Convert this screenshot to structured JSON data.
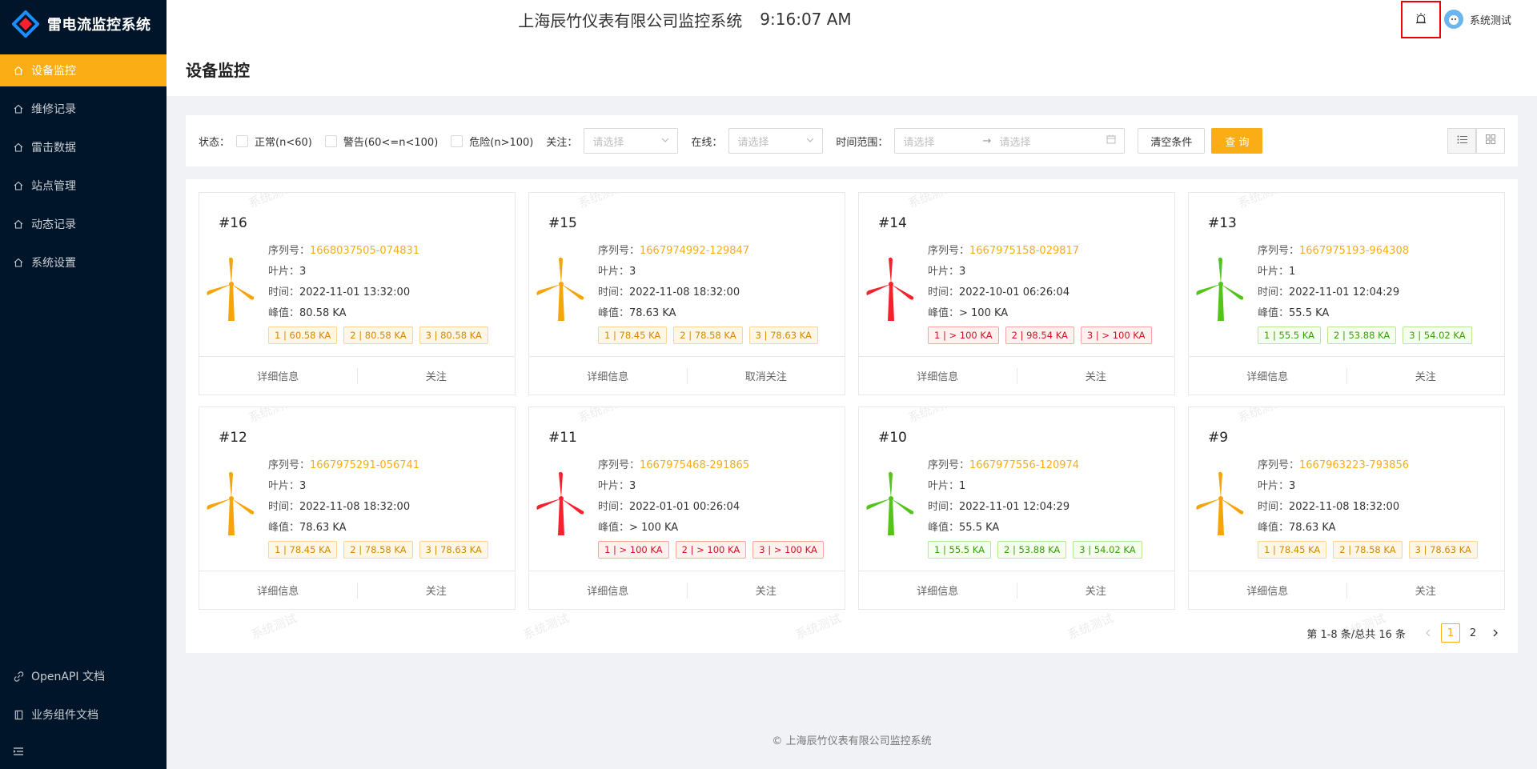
{
  "app": {
    "logo_text": "雷电流监控系统",
    "header_title": "上海辰竹仪表有限公司监控系统",
    "clock": "9:16:07 AM",
    "user_name": "系统测试"
  },
  "sidebar": {
    "items": [
      {
        "label": "设备监控",
        "icon": "home-icon",
        "active": true
      },
      {
        "label": "维修记录",
        "icon": "home-icon"
      },
      {
        "label": "雷击数据",
        "icon": "home-icon"
      },
      {
        "label": "站点管理",
        "icon": "home-icon"
      },
      {
        "label": "动态记录",
        "icon": "home-icon"
      },
      {
        "label": "系统设置",
        "icon": "home-icon"
      }
    ],
    "bottom": [
      {
        "label": "OpenAPI 文档",
        "icon": "link-icon"
      },
      {
        "label": "业务组件文档",
        "icon": "book-icon"
      }
    ]
  },
  "page": {
    "title": "设备监控"
  },
  "filter": {
    "status_label": "状态：",
    "status_options": [
      "正常(n<60)",
      "警告(60<=n<100)",
      "危险(n>100)"
    ],
    "follow_label": "关注：",
    "follow_placeholder": "请选择",
    "online_label": "在线：",
    "online_placeholder": "请选择",
    "time_label": "时间范围：",
    "time_start_placeholder": "请选择",
    "time_end_placeholder": "请选择",
    "clear_label": "清空条件",
    "query_label": "查 询"
  },
  "labels": {
    "serial": "序列号：",
    "blades": "叶片：",
    "time": "时间：",
    "peak": "峰值：",
    "detail": "详细信息"
  },
  "watermark": "系统测试",
  "cards": [
    {
      "id": "#16",
      "serial": "1668037505-074831",
      "blades": "3",
      "time": "2022-11-01 13:32:00",
      "peak": "80.58 KA",
      "level": "orange",
      "tags": [
        "1 | 60.58 KA",
        "2 | 80.58 KA",
        "3 | 80.58 KA"
      ],
      "follow": "关注"
    },
    {
      "id": "#15",
      "serial": "1667974992-129847",
      "blades": "3",
      "time": "2022-11-08 18:32:00",
      "peak": "78.63 KA",
      "level": "orange",
      "tags": [
        "1 | 78.45 KA",
        "2 | 78.58 KA",
        "3 | 78.63 KA"
      ],
      "follow": "取消关注"
    },
    {
      "id": "#14",
      "serial": "1667975158-029817",
      "blades": "3",
      "time": "2022-10-01 06:26:04",
      "peak": "> 100 KA",
      "level": "red",
      "tags": [
        "1 | > 100 KA",
        "2 | 98.54 KA",
        "3 | > 100 KA"
      ],
      "follow": "关注"
    },
    {
      "id": "#13",
      "serial": "1667975193-964308",
      "blades": "1",
      "time": "2022-11-01 12:04:29",
      "peak": "55.5 KA",
      "level": "green",
      "tags": [
        "1 | 55.5 KA",
        "2 | 53.88 KA",
        "3 | 54.02 KA"
      ],
      "follow": "关注"
    },
    {
      "id": "#12",
      "serial": "1667975291-056741",
      "blades": "3",
      "time": "2022-11-08 18:32:00",
      "peak": "78.63 KA",
      "level": "orange",
      "tags": [
        "1 | 78.45 KA",
        "2 | 78.58 KA",
        "3 | 78.63 KA"
      ],
      "follow": "关注"
    },
    {
      "id": "#11",
      "serial": "1667975468-291865",
      "blades": "3",
      "time": "2022-01-01 00:26:04",
      "peak": "> 100 KA",
      "level": "red",
      "tags": [
        "1 | > 100 KA",
        "2 | > 100 KA",
        "3 | > 100 KA"
      ],
      "follow": "关注"
    },
    {
      "id": "#10",
      "serial": "1667977556-120974",
      "blades": "1",
      "time": "2022-11-01 12:04:29",
      "peak": "55.5 KA",
      "level": "green",
      "tags": [
        "1 | 55.5 KA",
        "2 | 53.88 KA",
        "3 | 54.02 KA"
      ],
      "follow": "关注"
    },
    {
      "id": "#9",
      "serial": "1667963223-793856",
      "blades": "3",
      "time": "2022-11-08 18:32:00",
      "peak": "78.63 KA",
      "level": "orange",
      "tags": [
        "1 | 78.45 KA",
        "2 | 78.58 KA",
        "3 | 78.63 KA"
      ],
      "follow": "关注"
    }
  ],
  "pagination": {
    "summary": "第 1-8 条/总共 16 条",
    "pages": [
      "1",
      "2"
    ],
    "current": "1"
  },
  "footer": "上海辰竹仪表有限公司监控系统",
  "colors": {
    "accent": "#faad14",
    "sidebar_bg": "#001529",
    "level_orange": "#f5a50b",
    "level_red": "#f5222d",
    "level_green": "#52c41a"
  }
}
